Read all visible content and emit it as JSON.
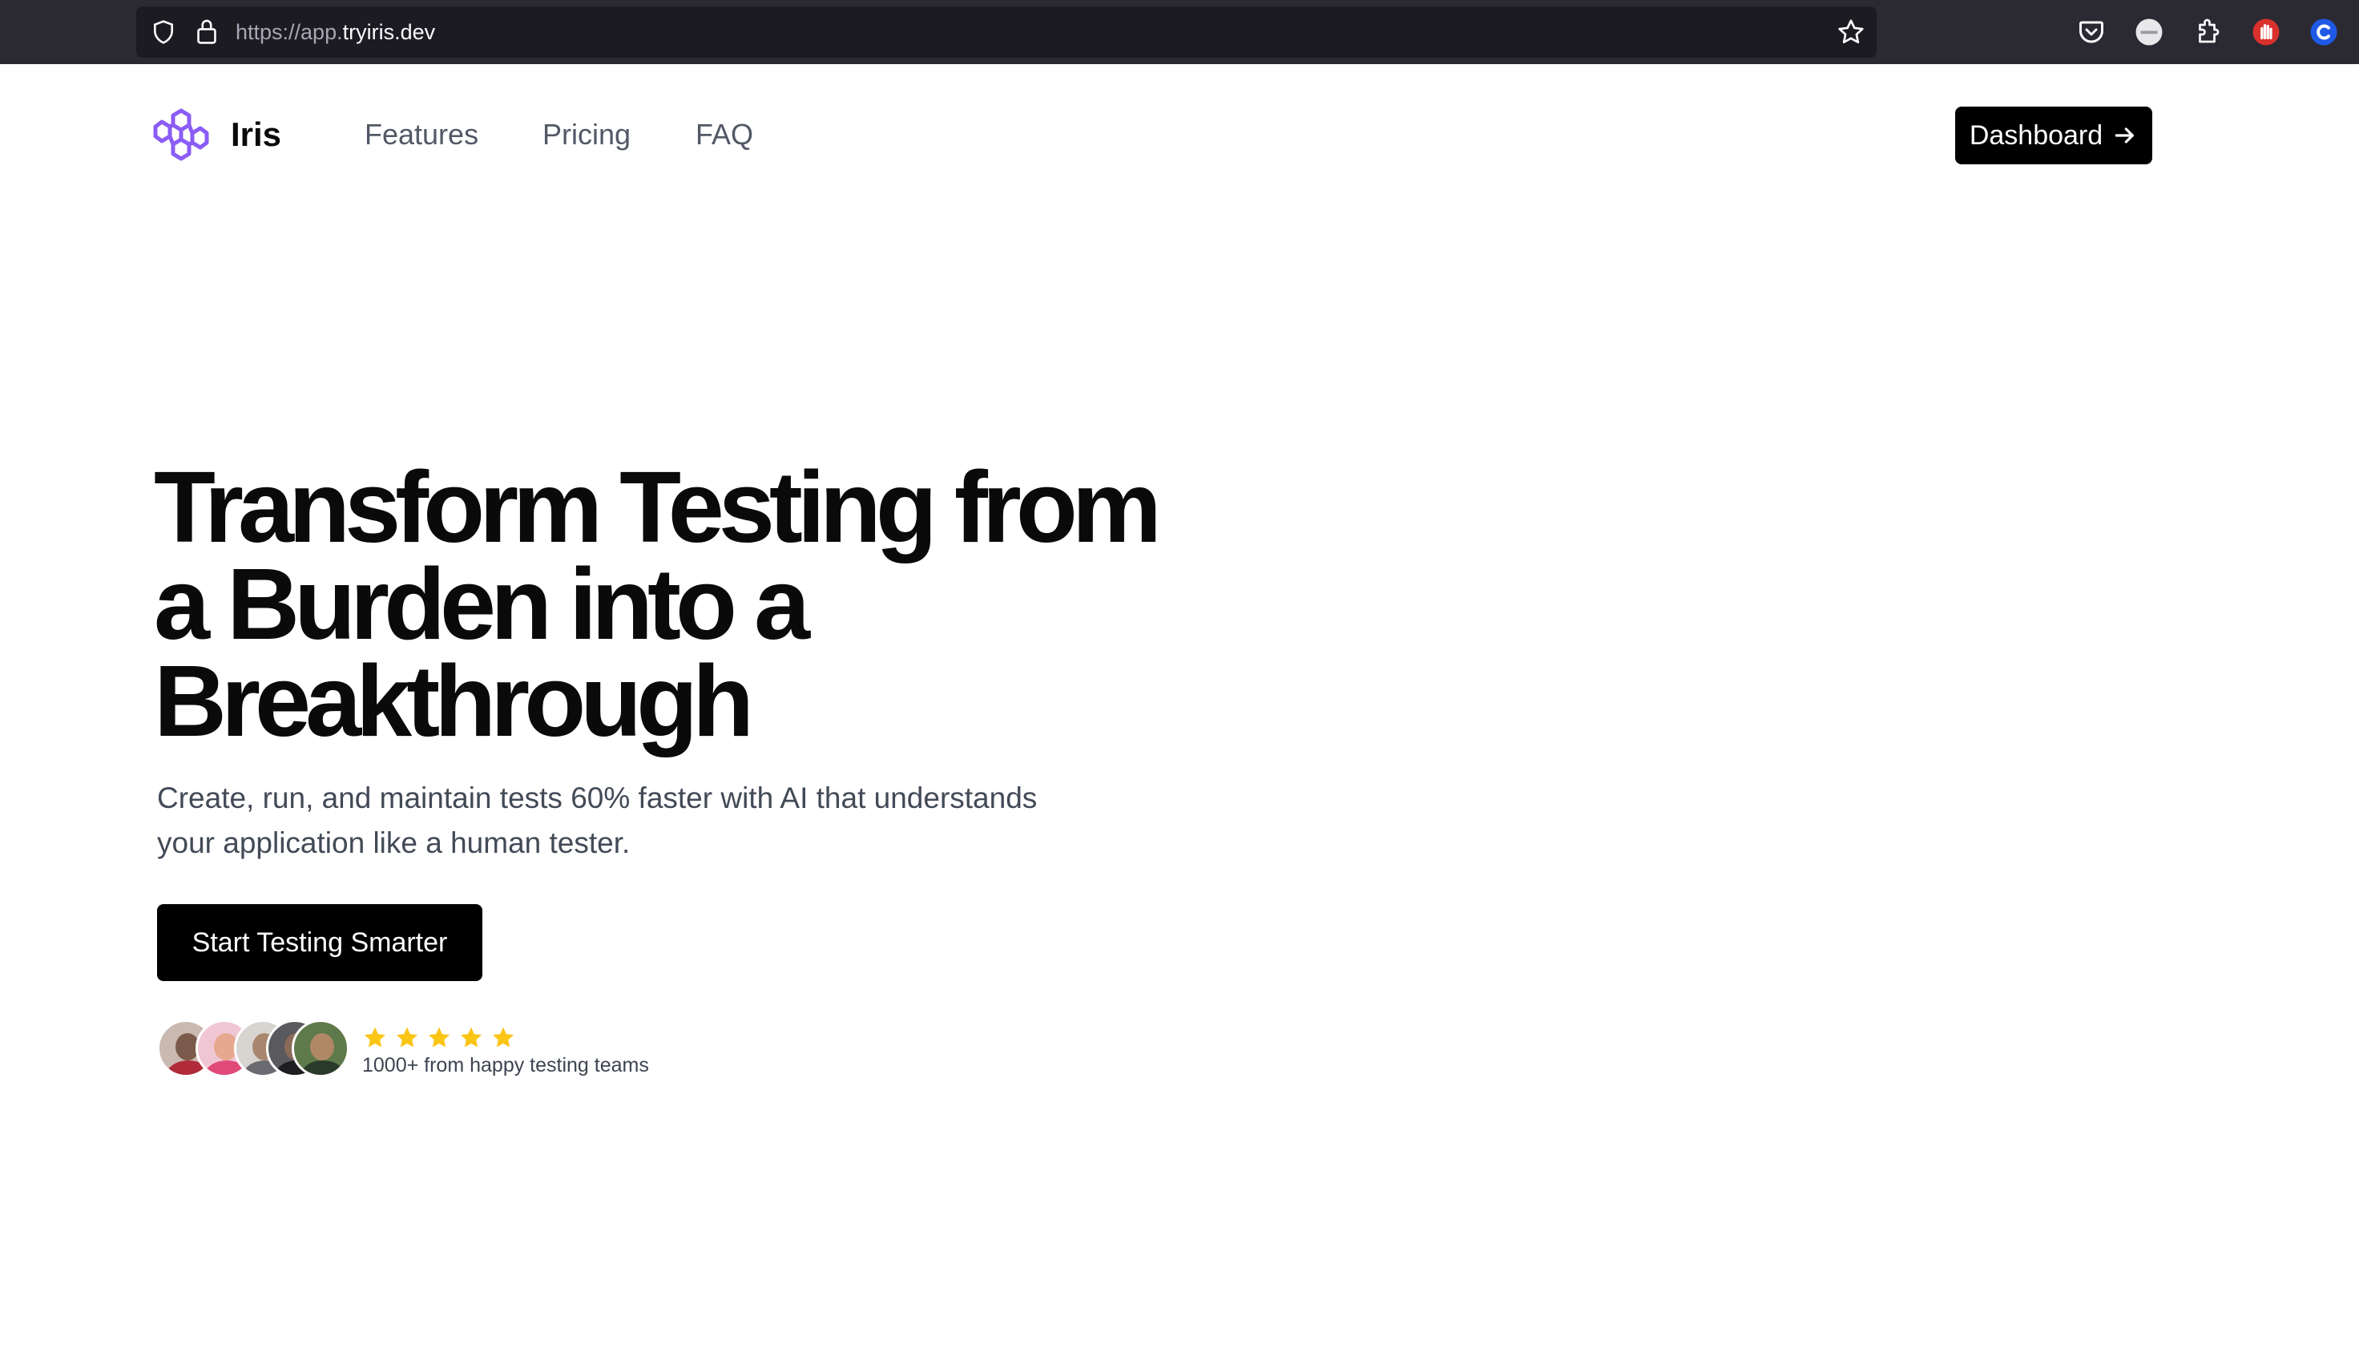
{
  "browser": {
    "url_scheme": "https://app.",
    "url_domain": "tryiris.dev",
    "extensions": [
      "pocket-icon",
      "grey-circle-extension-icon",
      "puzzle-extensions-icon",
      "red-hand-extension-icon",
      "blue-c-extension-icon"
    ]
  },
  "nav": {
    "brand": "Iris",
    "links": [
      "Features",
      "Pricing",
      "FAQ"
    ],
    "dashboard_label": "Dashboard"
  },
  "hero": {
    "title_lines": [
      "Transform Testing from",
      "a Burden into a",
      "Breakthrough"
    ],
    "subtitle_lines": [
      "Create, run, and maintain tests 60% faster with AI that understands",
      "your application like a human tester."
    ],
    "cta_label": "Start Testing Smarter"
  },
  "social_proof": {
    "avatar_count": 5,
    "rating_stars": 5,
    "rating_text": "1000+ from happy testing teams"
  },
  "colors": {
    "brand_purple": "#8b5cf6",
    "star_yellow": "#fac515",
    "button_black": "#000000",
    "browser_chrome": "#2b2a33"
  }
}
